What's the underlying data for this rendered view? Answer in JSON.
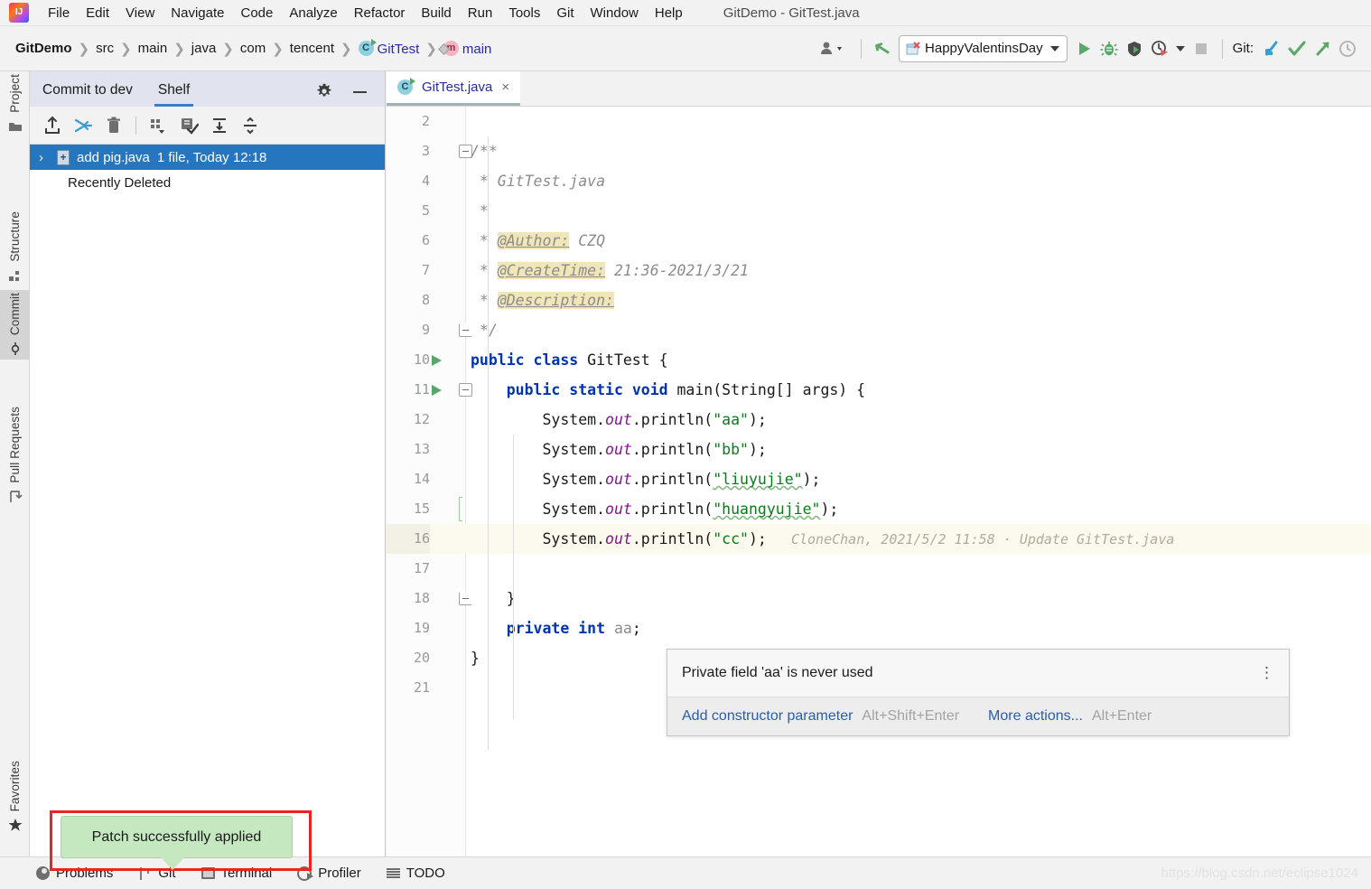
{
  "window": {
    "title": "GitDemo - GitTest.java"
  },
  "menubar": {
    "items": [
      {
        "label": "File",
        "mnemonic": "F"
      },
      {
        "label": "Edit",
        "mnemonic": "E"
      },
      {
        "label": "View",
        "mnemonic": "V"
      },
      {
        "label": "Navigate",
        "mnemonic": "N"
      },
      {
        "label": "Code",
        "mnemonic": "C"
      },
      {
        "label": "Analyze",
        "mnemonic": "z"
      },
      {
        "label": "Refactor",
        "mnemonic": "R"
      },
      {
        "label": "Build",
        "mnemonic": "B"
      },
      {
        "label": "Run",
        "mnemonic": "u"
      },
      {
        "label": "Tools",
        "mnemonic": "T"
      },
      {
        "label": "Git",
        "mnemonic": "G"
      },
      {
        "label": "Window",
        "mnemonic": "W"
      },
      {
        "label": "Help",
        "mnemonic": "H"
      }
    ]
  },
  "navbar": {
    "breadcrumbs": [
      {
        "label": "GitDemo",
        "style": "bold",
        "icon": ""
      },
      {
        "label": "src",
        "style": "",
        "icon": ""
      },
      {
        "label": "main",
        "style": "",
        "icon": ""
      },
      {
        "label": "java",
        "style": "",
        "icon": ""
      },
      {
        "label": "com",
        "style": "",
        "icon": ""
      },
      {
        "label": "tencent",
        "style": "",
        "icon": ""
      },
      {
        "label": "GitTest",
        "style": "blue",
        "icon": "class-icon"
      },
      {
        "label": "main",
        "style": "blue",
        "icon": "method-icon"
      }
    ],
    "toolbar": {
      "user_icon": "user-dropdown-icon",
      "updateproject_icon": "update-project-icon",
      "run_configuration": "HappyValentinsDay",
      "run_icon": "run-icon",
      "debug_icon": "debug-icon",
      "coverage_icon": "run-with-coverage-icon",
      "profile_icon": "profile-icon",
      "stop_icon": "stop-icon",
      "git_label": "Git:",
      "git_update_icon": "git-update-icon",
      "git_commit_icon": "git-commit-icon",
      "git_push_icon": "git-push-icon",
      "git_history_icon": "git-history-icon"
    }
  },
  "left_strip": {
    "items": [
      {
        "label": "Project",
        "icon": "project-folder-icon",
        "active": false
      },
      {
        "label": "Structure",
        "icon": "structure-icon",
        "active": false
      },
      {
        "label": "Commit",
        "icon": "commit-icon",
        "active": true
      },
      {
        "label": "Pull Requests",
        "icon": "pull-request-icon",
        "active": false
      },
      {
        "label": "Favorites",
        "icon": "star-icon",
        "active": false
      }
    ]
  },
  "shelf_panel": {
    "tabs": [
      {
        "label": "Commit to dev",
        "active": false
      },
      {
        "label": "Shelf",
        "active": true
      }
    ],
    "gear_icon": "settings-gear-icon",
    "minimize_icon": "minimize-icon",
    "toolbar_icons": [
      "unshelve-icon",
      "apply-patch-icon",
      "delete-icon",
      "group-by-icon",
      "shelve-silently-icon",
      "expand-all-icon",
      "collapse-all-icon"
    ],
    "rows": [
      {
        "label": "add pig.java",
        "meta": "1 file, Today 12:18",
        "selected": true,
        "icon": "patch-file-icon",
        "chevron": "›"
      },
      {
        "label": "Recently Deleted",
        "meta": "",
        "selected": false,
        "icon": "",
        "chevron": ""
      }
    ]
  },
  "editor": {
    "tab": {
      "name": "GitTest.java",
      "icon": "java-class-icon",
      "close": "×"
    },
    "lines": [
      {
        "n": "2",
        "segments": []
      },
      {
        "n": "3",
        "fold": "start",
        "segments": [
          {
            "t": "/**",
            "c": "cmt"
          }
        ]
      },
      {
        "n": "4",
        "segments": [
          {
            "t": " * GitTest.java",
            "c": "cmt"
          }
        ]
      },
      {
        "n": "5",
        "segments": [
          {
            "t": " *",
            "c": "cmt"
          }
        ]
      },
      {
        "n": "6",
        "segments": [
          {
            "t": " * ",
            "c": "cmt"
          },
          {
            "t": "@Author:",
            "c": "cmt hlmark u"
          },
          {
            "t": " CZQ",
            "c": "cmt"
          }
        ]
      },
      {
        "n": "7",
        "segments": [
          {
            "t": " * ",
            "c": "cmt"
          },
          {
            "t": "@CreateTime:",
            "c": "cmt hlmark u"
          },
          {
            "t": " 21:36-2021/3/21",
            "c": "cmt"
          }
        ]
      },
      {
        "n": "8",
        "segments": [
          {
            "t": " * ",
            "c": "cmt"
          },
          {
            "t": "@Description:",
            "c": "cmt hlmark u"
          }
        ]
      },
      {
        "n": "9",
        "fold": "end",
        "segments": [
          {
            "t": " */",
            "c": "cmt"
          }
        ]
      },
      {
        "n": "10",
        "run": true,
        "segments": [
          {
            "t": "public class ",
            "c": "kw"
          },
          {
            "t": "GitTest {",
            "c": "typ"
          }
        ]
      },
      {
        "n": "11",
        "run": true,
        "fold": "start2",
        "segments": [
          {
            "t": "    ",
            "c": "typ"
          },
          {
            "t": "public static void ",
            "c": "kw"
          },
          {
            "t": "main(String[] args) {",
            "c": "typ"
          }
        ]
      },
      {
        "n": "12",
        "segments": [
          {
            "t": "        System.",
            "c": "typ"
          },
          {
            "t": "out",
            "c": "fld"
          },
          {
            "t": ".println(",
            "c": "typ"
          },
          {
            "t": "\"aa\"",
            "c": "str"
          },
          {
            "t": ");",
            "c": "typ"
          }
        ]
      },
      {
        "n": "13",
        "segments": [
          {
            "t": "        System.",
            "c": "typ"
          },
          {
            "t": "out",
            "c": "fld"
          },
          {
            "t": ".println(",
            "c": "typ"
          },
          {
            "t": "\"bb\"",
            "c": "str"
          },
          {
            "t": ");",
            "c": "typ"
          }
        ]
      },
      {
        "n": "14",
        "segments": [
          {
            "t": "        System.",
            "c": "typ"
          },
          {
            "t": "out",
            "c": "fld"
          },
          {
            "t": ".println(",
            "c": "typ"
          },
          {
            "t": "\"liuyujie\"",
            "c": "str wavy"
          },
          {
            "t": ");",
            "c": "typ"
          }
        ]
      },
      {
        "n": "15",
        "change": true,
        "segments": [
          {
            "t": "        System.",
            "c": "typ"
          },
          {
            "t": "out",
            "c": "fld"
          },
          {
            "t": ".println(",
            "c": "typ"
          },
          {
            "t": "\"huangyujie\"",
            "c": "str wavy"
          },
          {
            "t": ");",
            "c": "typ"
          }
        ]
      },
      {
        "n": "16",
        "caret": true,
        "blame": "CloneChan, 2021/5/2 11:58 · Update GitTest.java",
        "segments": [
          {
            "t": "        System.",
            "c": "typ"
          },
          {
            "t": "out",
            "c": "fld"
          },
          {
            "t": ".println(",
            "c": "typ"
          },
          {
            "t": "\"cc\"",
            "c": "str"
          },
          {
            "t": ");",
            "c": "typ"
          }
        ]
      },
      {
        "n": "17",
        "segments": []
      },
      {
        "n": "18",
        "fold": "end2",
        "segments": [
          {
            "t": "    }",
            "c": "typ"
          }
        ]
      },
      {
        "n": "19",
        "segments": [
          {
            "t": "    ",
            "c": "typ"
          },
          {
            "t": "private int ",
            "c": "kw"
          },
          {
            "t": "aa",
            "c": "gray"
          },
          {
            "t": ";",
            "c": "typ"
          }
        ]
      },
      {
        "n": "20",
        "segments": [
          {
            "t": "}",
            "c": "typ"
          }
        ]
      },
      {
        "n": "21",
        "segments": []
      }
    ]
  },
  "inspection_popup": {
    "message": "Private field 'aa' is never used",
    "menu_icon": "more-options-icon",
    "actions": [
      {
        "label": "Add constructor parameter",
        "shortcut": "Alt+Shift+Enter"
      },
      {
        "label": "More actions...",
        "shortcut": "Alt+Enter"
      }
    ]
  },
  "notification": {
    "text": "Patch successfully applied",
    "highlight_color": "#ee2222",
    "balloon_color": "#c6e8c1"
  },
  "statusbar": {
    "items": [
      {
        "label": "Problems",
        "icon": "problems-icon"
      },
      {
        "label": "Git",
        "icon": "git-branch-icon"
      },
      {
        "label": "Terminal",
        "icon": "terminal-icon"
      },
      {
        "label": "Profiler",
        "icon": "profiler-icon"
      },
      {
        "label": "TODO",
        "icon": "todo-list-icon"
      }
    ],
    "watermark": "https://blog.csdn.net/eclipse1024"
  }
}
